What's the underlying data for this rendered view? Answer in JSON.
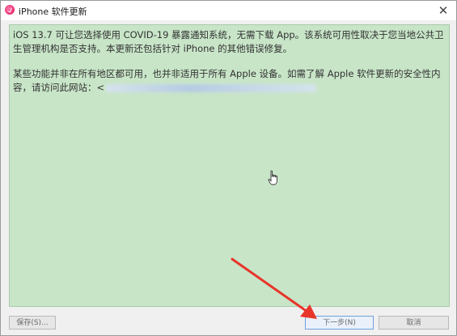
{
  "window": {
    "title": "iPhone 软件更新",
    "close_glyph": "✕"
  },
  "content": {
    "paragraph1": "iOS 13.7 可让您选择使用 COVID-19 暴露通知系统，无需下载 App。该系统可用性取决于您当地公共卫生管理机构是否支持。本更新还包括针对 iPhone 的其他错误修复。",
    "paragraph2": "某些功能并非在所有地区都可用，也并非适用于所有 Apple 设备。如需了解 Apple 软件更新的安全性内容，请访问此网站：<"
  },
  "buttons": {
    "save": "保存(S)...",
    "next": "下一步(N)",
    "cancel": "取消"
  },
  "colors": {
    "content_bg": "#c8e5c8",
    "arrow": "#e8352a"
  },
  "icons": {
    "app": "itunes-icon",
    "close": "close-icon",
    "cursor": "hand-cursor-icon"
  }
}
